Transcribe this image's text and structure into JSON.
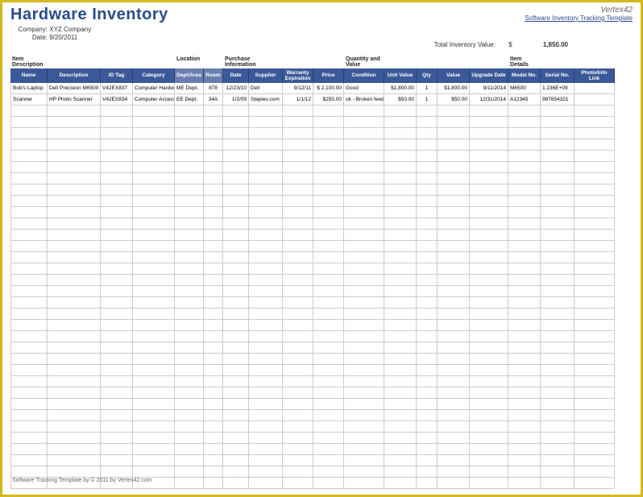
{
  "header": {
    "title": "Hardware Inventory",
    "logo_text": "Vertex42",
    "logo_link": "Software Inventory Tracking Template"
  },
  "meta": {
    "company_label": "Company:",
    "company_value": "XYZ Company",
    "date_label": "Date:",
    "date_value": "9/20/2011"
  },
  "totals": {
    "label": "Total Inventory Value:",
    "currency": "$",
    "value": "1,850.00"
  },
  "groups": {
    "item_desc": "Item Description",
    "location": "Location",
    "purchase": "Purchase Information",
    "quantity": "Quantity and Value",
    "details": "Item Details"
  },
  "columns": {
    "name": "Name",
    "description": "Description",
    "id_tag": "ID Tag",
    "category": "Category",
    "dept_area": "Dept/Area",
    "room": "Room",
    "pdate": "Date",
    "supplier": "Supplier",
    "warranty": "Warranty Expiration",
    "price": "Price",
    "condition": "Condition",
    "unit_value": "Unit Value",
    "qty": "Qty",
    "value": "Value",
    "upgrade": "Upgrade Date",
    "model": "Model No.",
    "serial": "Serial No.",
    "photo": "Photo/Info Link"
  },
  "rows": [
    {
      "name": "Bob's Laptop",
      "description": "Dell Precision M6500",
      "id_tag": "V42EX837",
      "category": "Computer Hardwa",
      "dept_area": "ME Dept.",
      "room": "878",
      "pdate": "12/23/10",
      "supplier": "Dell",
      "warranty": "9/12/11",
      "price": "$  2,100.00",
      "condition": "Good",
      "unit_value": "$1,800.00",
      "qty": "1",
      "value": "$1,800.00",
      "upgrade": "9/11/2014",
      "model": "M6500",
      "serial": "1.236E+09",
      "photo": ""
    },
    {
      "name": "Scanner",
      "description": "HP Photo Scanner",
      "id_tag": "V42EX834",
      "category": "Computer Accesso",
      "dept_area": "EE Dept.",
      "room": "34A",
      "pdate": "1/2/09",
      "supplier": "Staples.com",
      "warranty": "1/1/12",
      "price": "$250.00",
      "condition": "ok - Broken feede",
      "unit_value": "$50.00",
      "qty": "1",
      "value": "$50.00",
      "upgrade": "12/31/2014",
      "model": "A12345",
      "serial": "987654321",
      "photo": ""
    }
  ],
  "empty_row_count": 34,
  "footer": "Software Tracking Template by © 2011 by Vertex42.com"
}
